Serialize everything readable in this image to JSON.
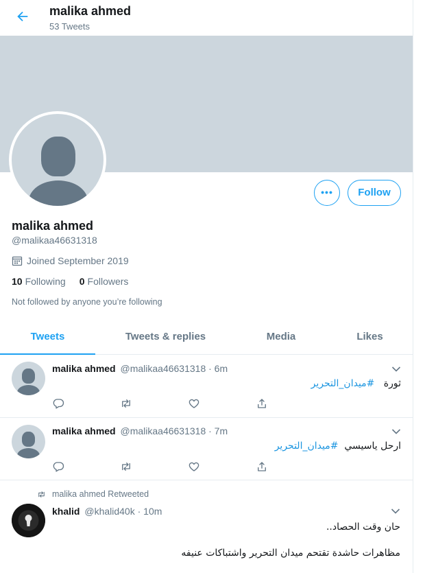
{
  "header": {
    "title": "malika ahmed",
    "tweet_count": "53 Tweets"
  },
  "profile": {
    "name": "malika ahmed",
    "handle": "@malikaa46631318",
    "joined": "Joined September 2019",
    "following_count": "10",
    "following_label": "Following",
    "followers_count": "0",
    "followers_label": "Followers",
    "not_followed": "Not followed by anyone you’re following",
    "more_label": "•••",
    "follow_label": "Follow"
  },
  "tabs": [
    {
      "label": "Tweets",
      "active": true
    },
    {
      "label": "Tweets & replies",
      "active": false
    },
    {
      "label": "Media",
      "active": false
    },
    {
      "label": "Likes",
      "active": false
    }
  ],
  "tweets": [
    {
      "name": "malika ahmed",
      "meta": "@malikaa46631318 · 6m",
      "text_plain": "ثورة",
      "hashtag": "#ميدان_التحرير"
    },
    {
      "name": "malika ahmed",
      "meta": "@malikaa46631318 · 7m",
      "text_plain": "ارحل ياسيسي",
      "hashtag": "#ميدان_التحرير"
    },
    {
      "retweet_label": "malika ahmed Retweeted",
      "name": "khalid",
      "meta": "@khalid40k · 10m",
      "line1": "حان وقت الحصاد..",
      "line2": "مظاهرات حاشدة تقتحم ميدان التحرير واشتباكات عنيفه"
    }
  ],
  "colors": {
    "accent": "#1da1f2",
    "banner": "#ccd6dd",
    "muted": "#657786"
  }
}
